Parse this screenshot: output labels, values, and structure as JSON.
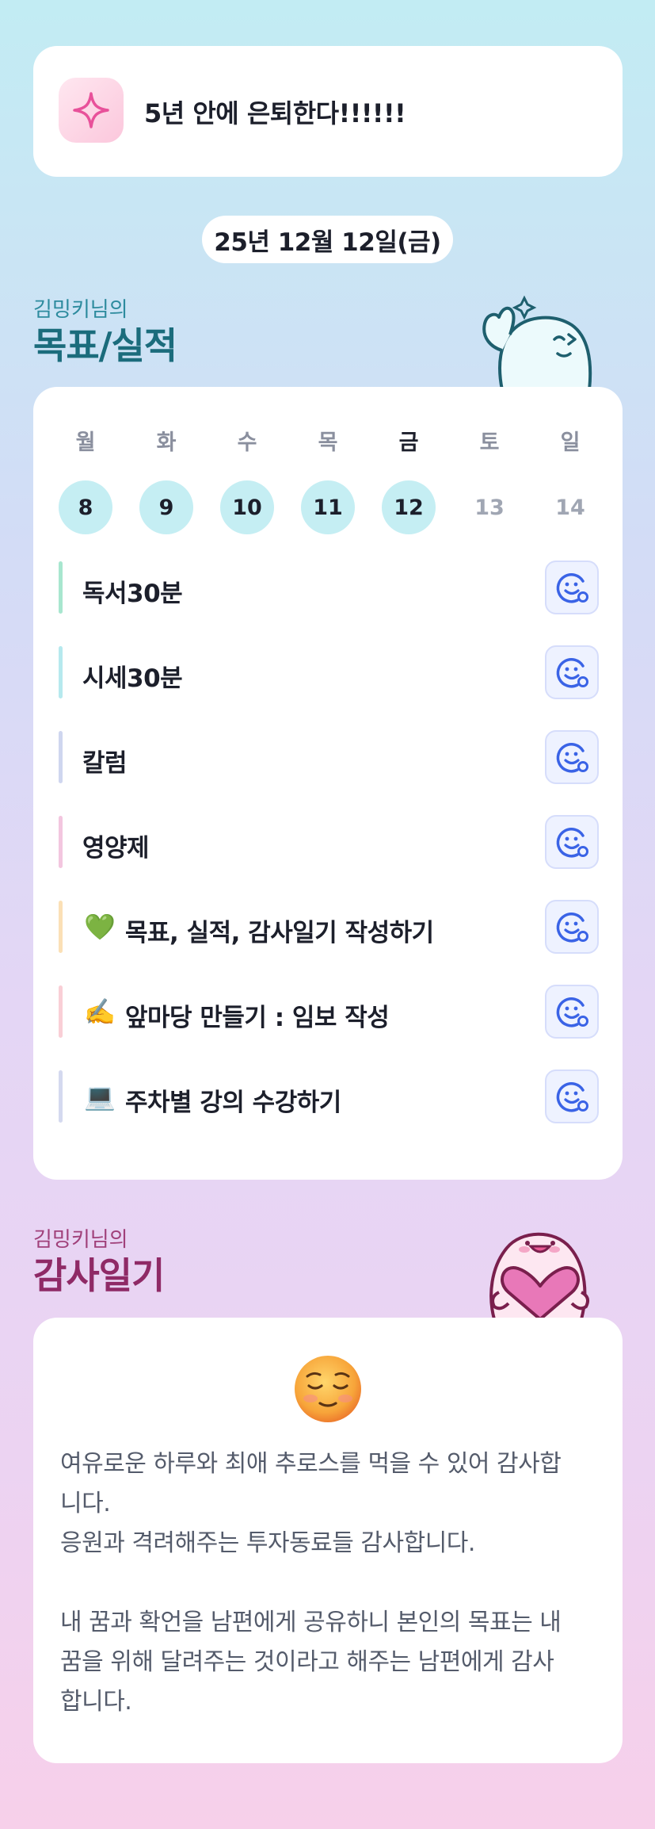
{
  "goal": {
    "title": "5년 안에 은퇴한다!!!!!!",
    "icon": "sparkle-icon"
  },
  "date_label": "25년 12월 12일(금)",
  "goals_section": {
    "subtitle": "김밍키님의",
    "title": "목표/실적"
  },
  "week": {
    "days": [
      {
        "name": "월",
        "num": "8",
        "state": "done"
      },
      {
        "name": "화",
        "num": "9",
        "state": "done"
      },
      {
        "name": "수",
        "num": "10",
        "state": "done"
      },
      {
        "name": "목",
        "num": "11",
        "state": "done"
      },
      {
        "name": "금",
        "num": "12",
        "state": "done",
        "active": true
      },
      {
        "name": "토",
        "num": "13",
        "state": "todo"
      },
      {
        "name": "일",
        "num": "14",
        "state": "todo"
      }
    ]
  },
  "goals": [
    {
      "emoji": "",
      "label": "독서30분",
      "bar_color": "#a8e6cf"
    },
    {
      "emoji": "",
      "label": "시세30분",
      "bar_color": "#b6e9ee"
    },
    {
      "emoji": "",
      "label": "칼럼",
      "bar_color": "#cfd6ef"
    },
    {
      "emoji": "",
      "label": "영양제",
      "bar_color": "#f3c6df"
    },
    {
      "emoji": "💚",
      "label": "목표, 실적, 감사일기 작성하기",
      "bar_color": "#fbe0b6"
    },
    {
      "emoji": "✍️",
      "label": "앞마당 만들기 : 임보 작성",
      "bar_color": "#f9cfd6"
    },
    {
      "emoji": "💻",
      "label": "주차별 강의 수강하기",
      "bar_color": "#d4d9ef"
    }
  ],
  "goal_action_icon": "smiley-add-icon",
  "gratitude_section": {
    "subtitle": "김밍키님의",
    "title": "감사일기"
  },
  "gratitude": {
    "emoji": "relieved-face-icon",
    "text": "여유로운 하루와 최애 추로스를 먹을 수 있어 감사합\n니다.\n응원과 격려해주는 투자동료들 감사합니다.\n\n내 꿈과 확언을 남편에게 공유하니 본인의 목표는 내\n꿈을 위해 달려주는 것이라고 해주는 남편에게 감사\n합니다."
  },
  "colors": {
    "accent_teal": "#1b6c7c",
    "accent_pink": "#8f2a66",
    "day_done_bg": "#c5eef3",
    "action_icon": "#3a63e6"
  }
}
